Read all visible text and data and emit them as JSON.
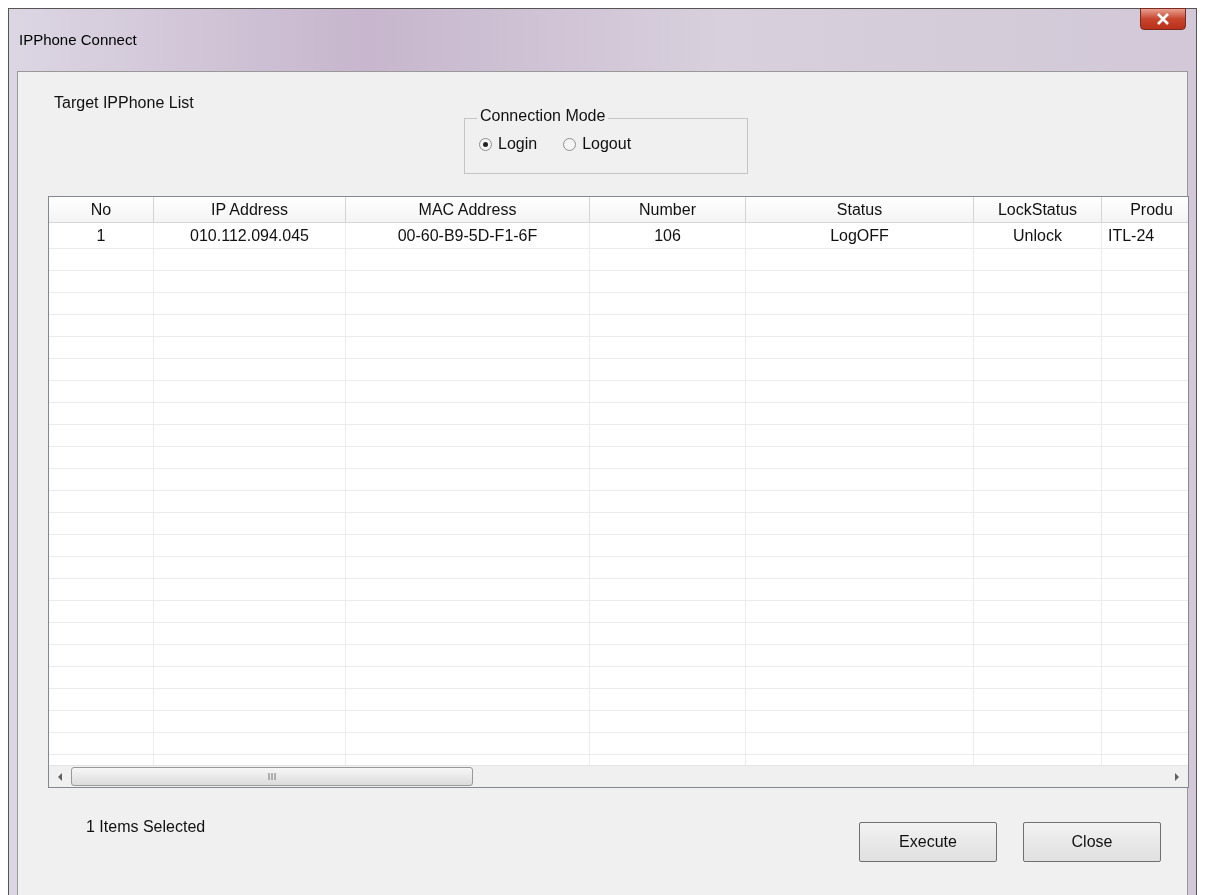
{
  "window": {
    "title": "IPPhone Connect"
  },
  "list_label": "Target IPPhone List",
  "connection_mode": {
    "title": "Connection Mode",
    "options": [
      {
        "label": "Login",
        "selected": true
      },
      {
        "label": "Logout",
        "selected": false
      }
    ]
  },
  "table": {
    "columns": [
      "No",
      "IP Address",
      "MAC Address",
      "Number",
      "Status",
      "LockStatus",
      "Produ"
    ],
    "rows": [
      [
        "1",
        "010.112.094.045",
        "00-60-B9-5D-F1-6F",
        "106",
        "LogOFF",
        "Unlock",
        "ITL-24"
      ]
    ]
  },
  "status_text": "1 Items Selected",
  "buttons": [
    "Execute",
    "Close"
  ]
}
